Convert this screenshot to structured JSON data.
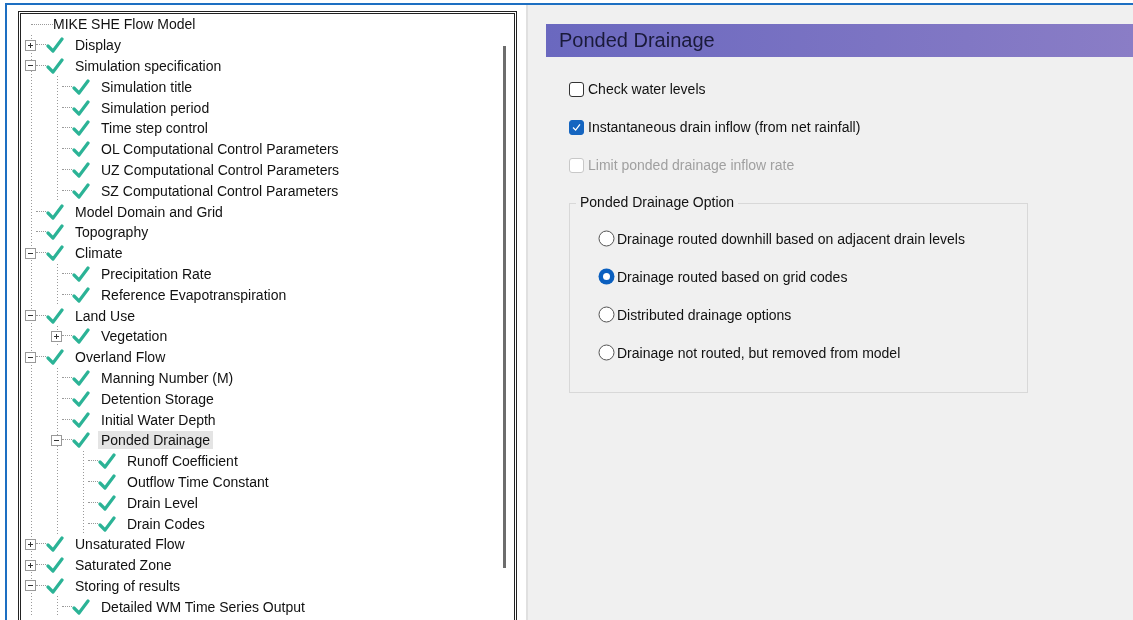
{
  "tree": {
    "root": {
      "label": "MIKE SHE Flow Model"
    },
    "items": [
      {
        "label": "Display",
        "valid": true,
        "selected": false,
        "expanded": false
      },
      {
        "label": "Simulation specification",
        "valid": true,
        "selected": false,
        "expanded": true,
        "children": [
          {
            "label": "Simulation title",
            "valid": true,
            "selected": false
          },
          {
            "label": "Simulation period",
            "valid": true,
            "selected": false
          },
          {
            "label": "Time step control",
            "valid": true,
            "selected": false
          },
          {
            "label": "OL Computational Control Parameters",
            "valid": true,
            "selected": false
          },
          {
            "label": "UZ Computational Control Parameters",
            "valid": true,
            "selected": false
          },
          {
            "label": "SZ Computational Control Parameters",
            "valid": true,
            "selected": false
          }
        ]
      },
      {
        "label": "Model Domain and Grid",
        "valid": true,
        "selected": false
      },
      {
        "label": "Topography",
        "valid": true,
        "selected": false
      },
      {
        "label": "Climate",
        "valid": true,
        "selected": false,
        "expanded": true,
        "children": [
          {
            "label": "Precipitation Rate",
            "valid": true,
            "selected": false
          },
          {
            "label": "Reference Evapotranspiration",
            "valid": true,
            "selected": false
          }
        ]
      },
      {
        "label": "Land Use",
        "valid": true,
        "selected": false,
        "expanded": true,
        "children": [
          {
            "label": "Vegetation",
            "valid": true,
            "selected": false,
            "expanded": false
          }
        ]
      },
      {
        "label": "Overland Flow",
        "valid": true,
        "selected": false,
        "expanded": true,
        "children": [
          {
            "label": "Manning Number (M)",
            "valid": true,
            "selected": false
          },
          {
            "label": "Detention Storage",
            "valid": true,
            "selected": false
          },
          {
            "label": "Initial Water Depth",
            "valid": true,
            "selected": false
          },
          {
            "label": "Ponded Drainage",
            "valid": true,
            "selected": true,
            "expanded": true,
            "children": [
              {
                "label": "Runoff Coefficient",
                "valid": true,
                "selected": false
              },
              {
                "label": "Outflow Time Constant",
                "valid": true,
                "selected": false
              },
              {
                "label": "Drain Level",
                "valid": true,
                "selected": false
              },
              {
                "label": "Drain Codes",
                "valid": true,
                "selected": false
              }
            ]
          }
        ]
      },
      {
        "label": "Unsaturated Flow",
        "valid": true,
        "selected": false,
        "expanded": false
      },
      {
        "label": "Saturated Zone",
        "valid": true,
        "selected": false,
        "expanded": false
      },
      {
        "label": "Storing of results",
        "valid": true,
        "selected": false,
        "expanded": true,
        "children": [
          {
            "label": "Detailed WM Time Series Output",
            "valid": true,
            "selected": false
          }
        ]
      }
    ]
  },
  "panel": {
    "title": "Ponded Drainage",
    "checkboxes": [
      {
        "label": "Check water levels",
        "checked": false,
        "disabled": false
      },
      {
        "label": "Instantaneous drain inflow (from net rainfall)",
        "checked": true,
        "disabled": false
      },
      {
        "label": "Limit ponded drainage inflow rate",
        "checked": false,
        "disabled": true
      }
    ],
    "option_group": {
      "title": "Ponded Drainage Option",
      "options": [
        {
          "label": "Drainage routed downhill based on adjacent drain levels",
          "selected": false
        },
        {
          "label": "Drainage routed based on grid codes",
          "selected": true
        },
        {
          "label": "Distributed drainage options",
          "selected": false
        },
        {
          "label": "Drainage not routed, but removed from model",
          "selected": false
        }
      ]
    }
  }
}
